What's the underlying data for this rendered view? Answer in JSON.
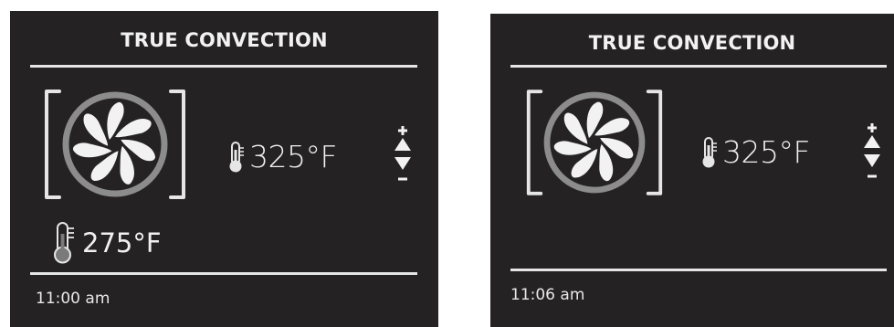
{
  "screens": [
    {
      "title": "TRUE CONVECTION",
      "set_temp": "325°F",
      "actual_temp": "275°F",
      "time": "11:00 am",
      "fan_icon": "convection-fan-icon",
      "thermometer_icon": "thermometer-icon",
      "adjust_icon": "temperature-up-down-icon"
    },
    {
      "title": "TRUE CONVECTION",
      "set_temp": "325°F",
      "time": "11:06 am",
      "fan_icon": "convection-fan-icon",
      "thermometer_icon": "thermometer-icon",
      "adjust_icon": "temperature-up-down-icon"
    }
  ],
  "colors": {
    "panel_bg": "#242222",
    "text": "#f2f2f2",
    "fan_ring": "#8c8c8c",
    "thermo_fill": "#7a7a7a"
  }
}
